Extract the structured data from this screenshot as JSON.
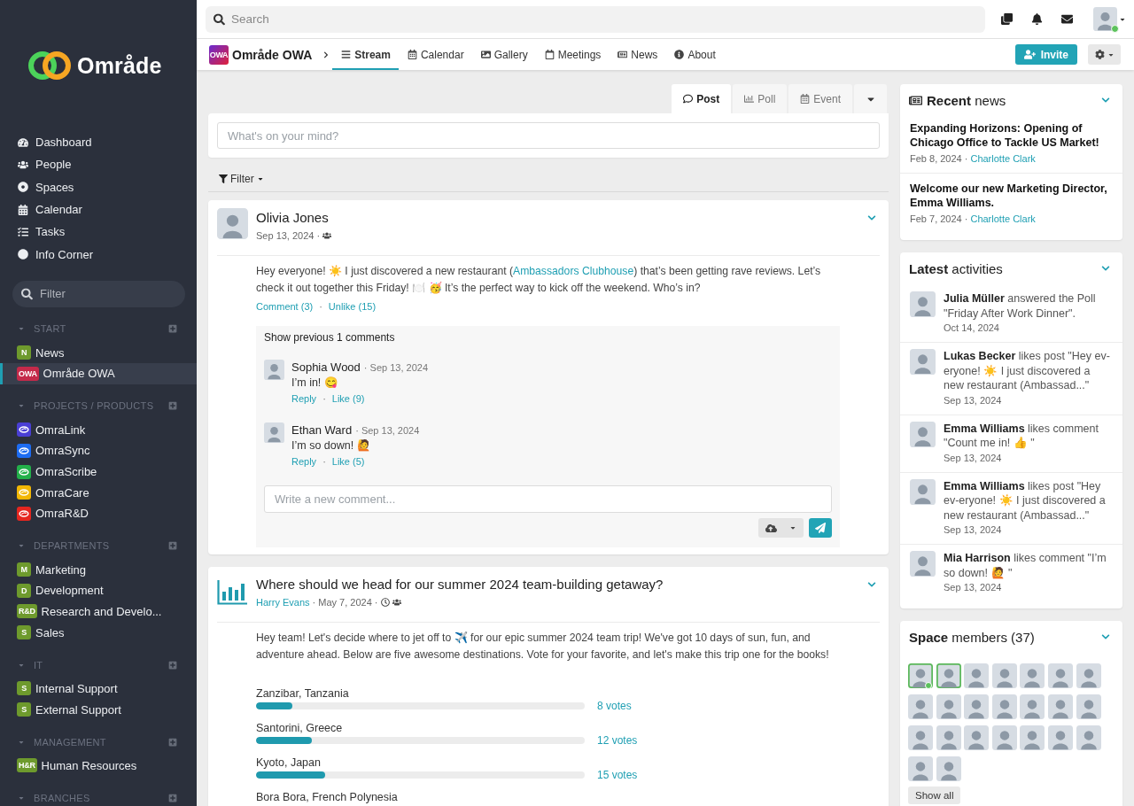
{
  "sidebar": {
    "logo": "Område",
    "nav": [
      {
        "label": "Dashboard",
        "selected": false
      },
      {
        "label": "People",
        "selected": false
      },
      {
        "label": "Spaces",
        "selected": false
      },
      {
        "label": "Calendar",
        "selected": false
      },
      {
        "label": "Tasks",
        "selected": false
      },
      {
        "label": "Info Corner",
        "selected": false
      }
    ],
    "filter": {
      "placeholder": "Filter"
    },
    "sections": [
      {
        "title": "START",
        "expanded": true,
        "items": [
          {
            "label": "News",
            "badge": "N",
            "color": "#6e9a2d",
            "selected": false
          },
          {
            "label": "Område OWA",
            "badge": "OWA",
            "color": "#c42a4a",
            "selected": true
          }
        ]
      },
      {
        "title": "PROJECTS / PRODUCTS",
        "expanded": true,
        "items": [
          {
            "label": "OmraLink",
            "color": "#4a3fd4",
            "selected": false
          },
          {
            "label": "OmraSync",
            "color": "#1d6cf2",
            "selected": false
          },
          {
            "label": "OmraScribe",
            "color": "#23b04a",
            "selected": false
          },
          {
            "label": "OmraCare",
            "color": "#f2b705",
            "selected": false
          },
          {
            "label": "OmraR&D",
            "color": "#e5261f",
            "selected": false
          }
        ]
      },
      {
        "title": "DEPARTMENTS",
        "expanded": true,
        "items": [
          {
            "label": "Marketing",
            "badge": "M",
            "color": "#6e9a2d",
            "selected": false
          },
          {
            "label": "Development",
            "badge": "D",
            "color": "#6e9a2d",
            "selected": false
          },
          {
            "label": "Research and Develo...",
            "badge": "R&D",
            "color": "#6e9a2d",
            "selected": false
          },
          {
            "label": "Sales",
            "badge": "S",
            "color": "#6e9a2d",
            "selected": false
          }
        ]
      },
      {
        "title": "IT",
        "expanded": true,
        "items": [
          {
            "label": "Internal Support",
            "badge": "S",
            "color": "#6e9a2d",
            "selected": false
          },
          {
            "label": "External Support",
            "badge": "S",
            "color": "#6e9a2d",
            "selected": false
          }
        ]
      },
      {
        "title": "MANAGEMENT",
        "expanded": true,
        "items": [
          {
            "label": "Human Resources",
            "badge": "H&R",
            "color": "#6e9a2d",
            "selected": false
          }
        ]
      },
      {
        "title": "BRANCHES",
        "expanded": true
      }
    ]
  },
  "topbar": {
    "search": {
      "placeholder": "Search"
    },
    "user": {
      "online": true
    }
  },
  "space_header": {
    "badge": "OWA",
    "title": "Område OWA",
    "tabs": [
      {
        "label": "Stream",
        "selected": true
      },
      {
        "label": "Calendar",
        "selected": false
      },
      {
        "label": "Gallery",
        "selected": false
      },
      {
        "label": "Meetings",
        "selected": false
      },
      {
        "label": "News",
        "selected": false
      },
      {
        "label": "About",
        "selected": false
      }
    ],
    "invite": "Invite"
  },
  "composer": {
    "tabs": [
      {
        "label": "Post",
        "selected": true
      },
      {
        "label": "Poll",
        "selected": false
      },
      {
        "label": "Event",
        "selected": false
      }
    ],
    "placeholder": "What's on your mind?"
  },
  "feed_filter": "Filter",
  "posts": [
    {
      "kind": "post",
      "author": "Olivia Jones",
      "date": "Sep 13, 2024 ·",
      "body": {
        "before": "Hey everyone! ☀️ I just discovered a new restaurant (",
        "link": "Ambassadors Clubhouse",
        "after": ") that’s been getting rave reviews. Let’s check it out together this Friday! 🍽️ 🥳 It’s the perfect way to kick off the weekend. Who’s in?"
      },
      "actions": [
        {
          "kind": "link",
          "label": "Comment (3)"
        },
        {
          "kind": "separator",
          "label": "·"
        },
        {
          "kind": "link",
          "label": "Unlike (15)"
        }
      ],
      "show_previous": "Show previous 1 comments",
      "comments": [
        {
          "author": "Sophia Wood",
          "date": "· Sep 13, 2024",
          "text": "I’m in! 😋",
          "actions": [
            {
              "kind": "link",
              "label": "Reply"
            },
            {
              "kind": "separator",
              "label": "·"
            },
            {
              "kind": "link",
              "label": "Like (9)"
            }
          ]
        },
        {
          "author": "Ethan Ward",
          "date": "· Sep 13, 2024",
          "text": "I’m so down! 🙋",
          "actions": [
            {
              "kind": "link",
              "label": "Reply"
            },
            {
              "kind": "separator",
              "label": "·"
            },
            {
              "kind": "link",
              "label": "Like (5)"
            }
          ]
        }
      ],
      "comment_placeholder": "Write a new comment..."
    },
    {
      "kind": "poll",
      "question": "Where should we head for our summer 2024 team-building getaway?",
      "author": "Harry Evans",
      "date": "· May 7, 2024 ·",
      "body": "Hey team! Let's decide where to jet off to ✈️ for our epic summer 2024 team trip! We've got 10 days of sun, fun, and adventure ahead. Below are five awesome destinations. Vote for your favorite, and let's make this trip one for the books!",
      "options": [
        {
          "label": "Zanzibar, Tanzania",
          "level": 0.11,
          "votes": "8 votes"
        },
        {
          "label": "Santorini, Greece",
          "level": 0.17,
          "votes": "12 votes"
        },
        {
          "label": "Kyoto, Japan",
          "level": 0.21,
          "votes": "15 votes"
        },
        {
          "label": "Bora Bora, French Polynesia"
        }
      ]
    }
  ],
  "recent_news": {
    "title": "**Recent** news",
    "items": [
      {
        "title": "Expanding Horizons: Opening of Chicago Office to Tackle US Market!",
        "date": "Feb 8, 2024 ·",
        "author": "Charlotte Clark"
      },
      {
        "title": "Welcome our new Marketing Director, Emma Williams.",
        "date": "Feb 7, 2024 ·",
        "author": "Charlotte Clark"
      }
    ]
  },
  "latest_activities": {
    "title": "**Latest** activities",
    "items": [
      {
        "text": "**Julia Müller** answered the Poll \"Friday After Work Dinner\".",
        "date": "Oct 14, 2024"
      },
      {
        "text": "**Lukas Becker** likes post \"Hey ev-eryone! ☀️ I just discovered a new restaurant (Ambassad...\"",
        "date": "Sep 13, 2024"
      },
      {
        "text": "**Emma Williams** likes comment \"Count me in! 👍 \"",
        "date": "Sep 13, 2024"
      },
      {
        "text": "**Emma Williams** likes post \"Hey ev-eryone! ☀️ I just discovered a new restaurant (Ambassad...\"",
        "date": "Sep 13, 2024"
      },
      {
        "text": "**Mia Harrison** likes comment \"I’m so down! 🙋 \"",
        "date": "Sep 13, 2024"
      }
    ]
  },
  "space_members": {
    "title": "**Space** members (37)",
    "members": [
      {
        "online": true,
        "dot": true
      },
      {
        "online": true,
        "dot": false
      },
      {
        "online": false,
        "dot": false
      },
      {
        "online": false,
        "dot": false
      },
      {
        "online": false,
        "dot": false
      },
      {
        "online": false,
        "dot": false
      },
      {
        "online": false,
        "dot": false
      },
      {
        "online": false,
        "dot": false
      },
      {
        "online": false,
        "dot": false
      },
      {
        "online": false,
        "dot": false
      },
      {
        "online": false,
        "dot": false
      },
      {
        "online": false,
        "dot": false
      },
      {
        "online": false,
        "dot": false
      },
      {
        "online": false,
        "dot": false
      },
      {
        "online": false,
        "dot": false
      },
      {
        "online": false,
        "dot": false
      },
      {
        "online": false,
        "dot": false
      },
      {
        "online": false,
        "dot": false
      },
      {
        "online": false,
        "dot": false
      },
      {
        "online": false,
        "dot": false
      },
      {
        "online": false,
        "dot": false
      },
      {
        "online": false,
        "dot": false
      },
      {
        "online": false,
        "dot": false
      }
    ],
    "show_all": "Show all"
  }
}
